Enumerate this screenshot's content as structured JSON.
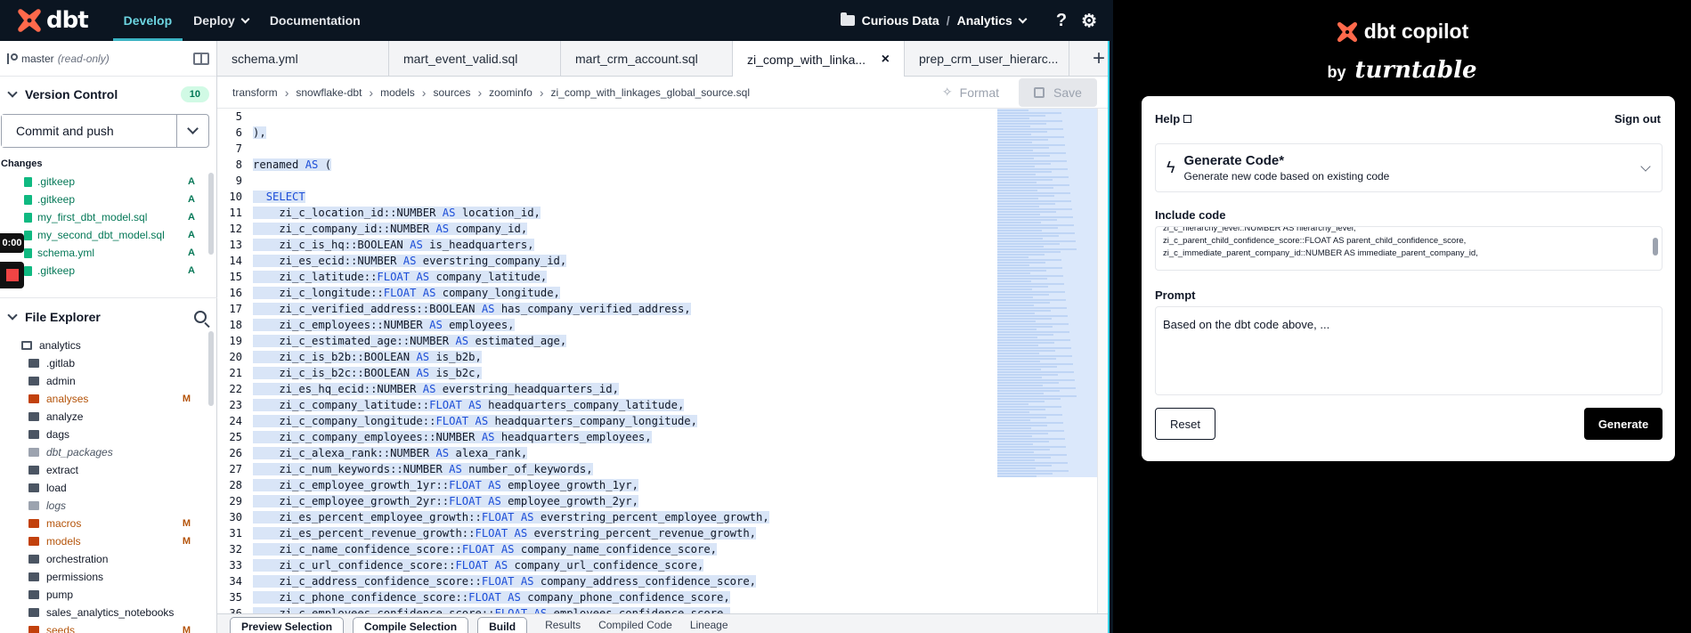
{
  "topnav": {
    "logo_text": "dbt",
    "items": [
      {
        "label": "Develop",
        "active": true
      },
      {
        "label": "Deploy",
        "has_caret": true
      },
      {
        "label": "Documentation"
      }
    ],
    "project": {
      "org": "Curious Data",
      "separator": "/",
      "name": "Analytics"
    },
    "help_glyph": "?",
    "settings_glyph": "⚙"
  },
  "sidebar": {
    "branch": "master",
    "readonly": "(read-only)",
    "version_control": {
      "title": "Version Control",
      "count": "10"
    },
    "commit_label": "Commit and push",
    "changes_label": "Changes",
    "changes": [
      {
        "name": ".gitkeep",
        "status": "A"
      },
      {
        "name": ".gitkeep",
        "status": "A"
      },
      {
        "name": "my_first_dbt_model.sql",
        "status": "A"
      },
      {
        "name": "my_second_dbt_model.sql",
        "status": "A"
      },
      {
        "name": "schema.yml",
        "status": "A"
      },
      {
        "name": ".gitkeep",
        "status": "A"
      }
    ],
    "file_explorer": {
      "title": "File Explorer"
    },
    "tree": [
      {
        "name": "analytics",
        "indent": 0,
        "open": true
      },
      {
        "name": ".gitlab",
        "indent": 1
      },
      {
        "name": "admin",
        "indent": 1
      },
      {
        "name": "analyses",
        "indent": 1,
        "status": "M"
      },
      {
        "name": "analyze",
        "indent": 1
      },
      {
        "name": "dags",
        "indent": 1
      },
      {
        "name": "dbt_packages",
        "indent": 1,
        "italic": true
      },
      {
        "name": "extract",
        "indent": 1
      },
      {
        "name": "load",
        "indent": 1
      },
      {
        "name": "logs",
        "indent": 1,
        "italic": true
      },
      {
        "name": "macros",
        "indent": 1,
        "status": "M"
      },
      {
        "name": "models",
        "indent": 1,
        "status": "M"
      },
      {
        "name": "orchestration",
        "indent": 1
      },
      {
        "name": "permissions",
        "indent": 1
      },
      {
        "name": "pump",
        "indent": 1
      },
      {
        "name": "sales_analytics_notebooks",
        "indent": 1
      },
      {
        "name": "seeds",
        "indent": 1,
        "status": "M"
      }
    ]
  },
  "recorder": {
    "time": "0:00"
  },
  "tabs": [
    {
      "label": "schema.yml"
    },
    {
      "label": "mart_event_valid.sql"
    },
    {
      "label": "mart_crm_account.sql"
    },
    {
      "label": "zi_comp_with_linka...",
      "active": true,
      "close": "×"
    },
    {
      "label": "prep_crm_user_hierarc..."
    }
  ],
  "tab_add": "+",
  "breadcrumbs": [
    "transform",
    "snowflake-dbt",
    "models",
    "sources",
    "zoominfo",
    "zi_comp_with_linkages_global_source.sql"
  ],
  "toolbar": {
    "format_label": "Format",
    "save_label": "Save"
  },
  "code_lines": [
    {
      "n": "5",
      "t": ""
    },
    {
      "n": "6",
      "t": "),"
    },
    {
      "n": "7",
      "t": ""
    },
    {
      "n": "8",
      "t": "renamed AS ("
    },
    {
      "n": "9",
      "t": ""
    },
    {
      "n": "10",
      "t": "  SELECT"
    },
    {
      "n": "11",
      "t": "    zi_c_location_id::NUMBER AS location_id,"
    },
    {
      "n": "12",
      "t": "    zi_c_company_id::NUMBER AS company_id,"
    },
    {
      "n": "13",
      "t": "    zi_c_is_hq::BOOLEAN AS is_headquarters,"
    },
    {
      "n": "14",
      "t": "    zi_es_ecid::NUMBER AS everstring_company_id,"
    },
    {
      "n": "15",
      "t": "    zi_c_latitude::FLOAT AS company_latitude,"
    },
    {
      "n": "16",
      "t": "    zi_c_longitude::FLOAT AS company_longitude,"
    },
    {
      "n": "17",
      "t": "    zi_c_verified_address::BOOLEAN AS has_company_verified_address,"
    },
    {
      "n": "18",
      "t": "    zi_c_employees::NUMBER AS employees,"
    },
    {
      "n": "19",
      "t": "    zi_c_estimated_age::NUMBER AS estimated_age,"
    },
    {
      "n": "20",
      "t": "    zi_c_is_b2b::BOOLEAN AS is_b2b,"
    },
    {
      "n": "21",
      "t": "    zi_c_is_b2c::BOOLEAN AS is_b2c,"
    },
    {
      "n": "22",
      "t": "    zi_es_hq_ecid::NUMBER AS everstring_headquarters_id,"
    },
    {
      "n": "23",
      "t": "    zi_c_company_latitude::FLOAT AS headquarters_company_latitude,"
    },
    {
      "n": "24",
      "t": "    zi_c_company_longitude::FLOAT AS headquarters_company_longitude,"
    },
    {
      "n": "25",
      "t": "    zi_c_company_employees::NUMBER AS headquarters_employees,"
    },
    {
      "n": "26",
      "t": "    zi_c_alexa_rank::NUMBER AS alexa_rank,"
    },
    {
      "n": "27",
      "t": "    zi_c_num_keywords::NUMBER AS number_of_keywords,"
    },
    {
      "n": "28",
      "t": "    zi_c_employee_growth_1yr::FLOAT AS employee_growth_1yr,"
    },
    {
      "n": "29",
      "t": "    zi_c_employee_growth_2yr::FLOAT AS employee_growth_2yr,"
    },
    {
      "n": "30",
      "t": "    zi_es_percent_employee_growth::FLOAT AS everstring_percent_employee_growth,"
    },
    {
      "n": "31",
      "t": "    zi_es_percent_revenue_growth::FLOAT AS everstring_percent_revenue_growth,"
    },
    {
      "n": "32",
      "t": "    zi_c_name_confidence_score::FLOAT AS company_name_confidence_score,"
    },
    {
      "n": "33",
      "t": "    zi_c_url_confidence_score::FLOAT AS company_url_confidence_score,"
    },
    {
      "n": "34",
      "t": "    zi_c_address_confidence_score::FLOAT AS company_address_confidence_score,"
    },
    {
      "n": "35",
      "t": "    zi_c_phone_confidence_score::FLOAT AS company_phone_confidence_score,"
    },
    {
      "n": "36",
      "t": "    zi_c_employees_confidence_score::FLOAT AS employees_confidence_score,"
    }
  ],
  "bottom": {
    "buttons": [
      "Preview Selection",
      "Compile Selection",
      "Build"
    ],
    "tabs": [
      "Results",
      "Compiled Code",
      "Lineage"
    ]
  },
  "copilot": {
    "title": "dbt copilot",
    "by": "by",
    "brand": "turntable",
    "help": "Help",
    "signout": "Sign out",
    "mode_title": "Generate Code*",
    "mode_sub": "Generate new code based on existing code",
    "include_label": "Include code",
    "include_lines": [
      "zi_c_hierarchy_level::NUMBER AS hierarchy_level,",
      "zi_c_parent_child_confidence_score::FLOAT AS parent_child_confidence_score,",
      "zi_c_immediate_parent_company_id::NUMBER AS immediate_parent_company_id,"
    ],
    "prompt_label": "Prompt",
    "prompt_placeholder": "Based on the dbt code above, ...",
    "reset_label": "Reset",
    "generate_label": "Generate"
  },
  "colors": {
    "nav_bg": "#0b1521",
    "accent": "#3bb3c3",
    "brand_orange": "#ff694b",
    "added_green": "#047857",
    "modified_orange": "#b45309"
  }
}
